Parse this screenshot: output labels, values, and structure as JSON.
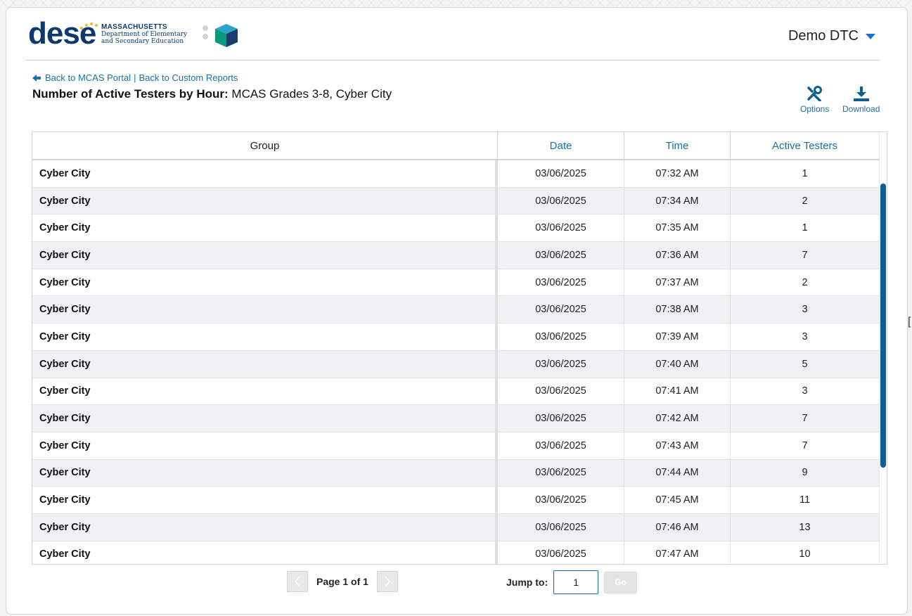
{
  "logo": {
    "wordmark": "dese",
    "line1": "MASSACHUSETTS",
    "line2": "Department of Elementary",
    "line3": "and Secondary Education"
  },
  "user_menu": {
    "label": "Demo DTC"
  },
  "nav": {
    "back_portal": "Back to MCAS Portal",
    "separator": "|",
    "back_reports": "Back to Custom Reports"
  },
  "report": {
    "title_bold": "Number of Active Testers by Hour:",
    "title_rest": "MCAS Grades 3-8, Cyber City"
  },
  "tools": {
    "options_label": "Options",
    "download_label": "Download"
  },
  "table": {
    "columns": [
      "Group",
      "Date",
      "Time",
      "Active Testers"
    ],
    "rows": [
      [
        "Cyber City",
        "03/06/2025",
        "07:32 AM",
        "1"
      ],
      [
        "Cyber City",
        "03/06/2025",
        "07:34 AM",
        "2"
      ],
      [
        "Cyber City",
        "03/06/2025",
        "07:35 AM",
        "1"
      ],
      [
        "Cyber City",
        "03/06/2025",
        "07:36 AM",
        "7"
      ],
      [
        "Cyber City",
        "03/06/2025",
        "07:37 AM",
        "2"
      ],
      [
        "Cyber City",
        "03/06/2025",
        "07:38 AM",
        "3"
      ],
      [
        "Cyber City",
        "03/06/2025",
        "07:39 AM",
        "3"
      ],
      [
        "Cyber City",
        "03/06/2025",
        "07:40 AM",
        "5"
      ],
      [
        "Cyber City",
        "03/06/2025",
        "07:41 AM",
        "3"
      ],
      [
        "Cyber City",
        "03/06/2025",
        "07:42 AM",
        "7"
      ],
      [
        "Cyber City",
        "03/06/2025",
        "07:43 AM",
        "7"
      ],
      [
        "Cyber City",
        "03/06/2025",
        "07:44 AM",
        "9"
      ],
      [
        "Cyber City",
        "03/06/2025",
        "07:45 AM",
        "11"
      ],
      [
        "Cyber City",
        "03/06/2025",
        "07:46 AM",
        "13"
      ],
      [
        "Cyber City",
        "03/06/2025",
        "07:47 AM",
        "10"
      ]
    ]
  },
  "pager": {
    "page_text": "Page 1 of 1",
    "jump_label": "Jump to:",
    "jump_value": "1",
    "go_label": "Go"
  },
  "colors": {
    "brand_navy": "#0d3a6b",
    "link_blue": "#1a6faa",
    "scroll_thumb": "#0d5f93"
  }
}
